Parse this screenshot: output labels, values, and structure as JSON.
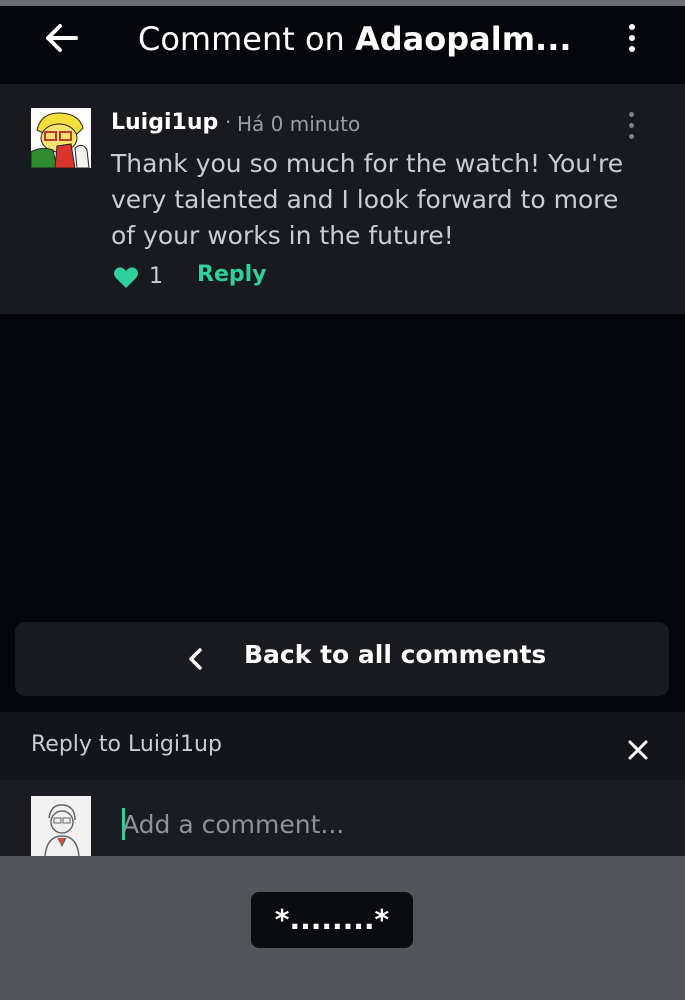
{
  "header": {
    "title_prefix": "Comment on ",
    "title_name": "Adaopalm...",
    "back_icon": "arrow-left-icon",
    "menu_icon": "kebab-vertical-icon"
  },
  "comment": {
    "author": "Luigi1up",
    "separator": "·",
    "time": "Há 0 minuto",
    "body": "Thank you so much for the watch! You're very talented and I look forward to more of your works in the future!",
    "likes": "1",
    "reply_label": "Reply"
  },
  "back_to_all": {
    "label": "Back to all comments"
  },
  "reply_bar": {
    "label": "Reply to Luigi1up"
  },
  "composer": {
    "placeholder": "Add a comment...",
    "value": ""
  },
  "toast": {
    "text": "*........*"
  },
  "colors": {
    "accent": "#2fd09a",
    "background": "#03050a",
    "card": "#181a20"
  }
}
